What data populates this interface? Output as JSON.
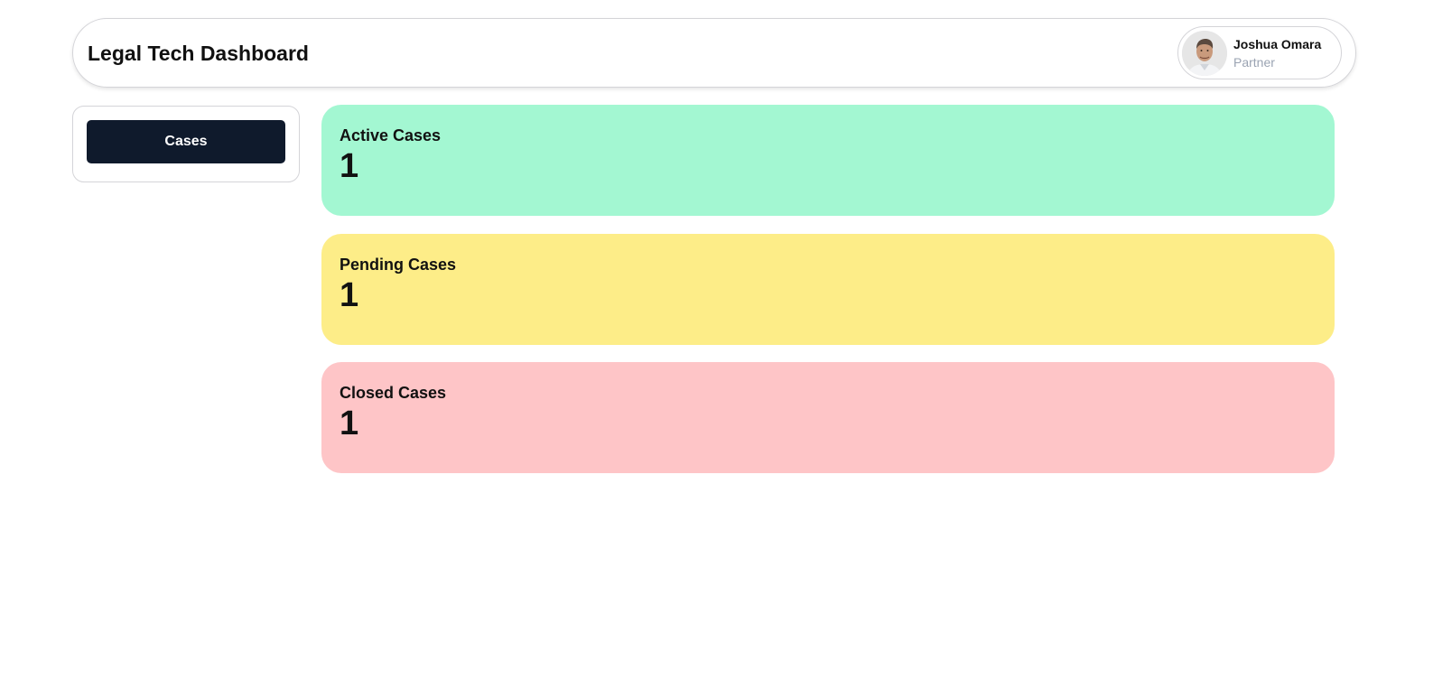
{
  "header": {
    "title": "Legal Tech Dashboard"
  },
  "user": {
    "name": "Joshua Omara",
    "role": "Partner",
    "avatar_icon": "user-avatar-photo"
  },
  "sidebar": {
    "items": [
      {
        "label": "Cases",
        "active": true
      }
    ]
  },
  "stats": [
    {
      "label": "Active Cases",
      "value": "1",
      "color": "#a3f7d2"
    },
    {
      "label": "Pending Cases",
      "value": "1",
      "color": "#fded88"
    },
    {
      "label": "Closed Cases",
      "value": "1",
      "color": "#fec5c7"
    }
  ],
  "colors": {
    "nav_active_bg": "#0f1a2c",
    "border": "#d4d4d8",
    "muted_text": "#9aa3b2"
  }
}
